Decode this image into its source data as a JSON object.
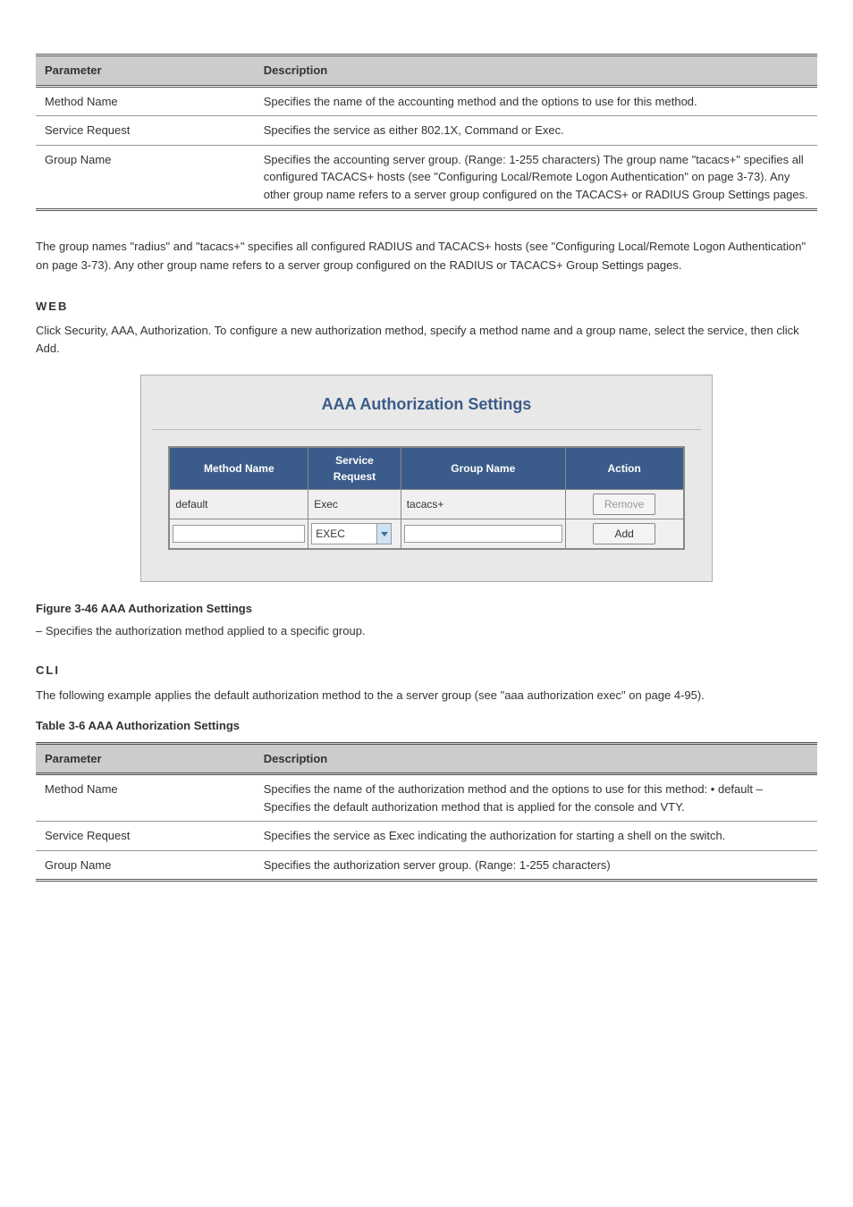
{
  "spec_table_top": {
    "headers": [
      "Parameter",
      "Description"
    ],
    "rows": [
      {
        "param": "Method Name",
        "desc": "Specifies the name of the accounting method and the options to use for this method."
      },
      {
        "param": "Service Request",
        "desc": "Specifies the service as either 802.1X, Command or Exec."
      },
      {
        "param": "Group Name",
        "desc": "Specifies the accounting server group. (Range: 1-255 characters)\nThe group name \"tacacs+\" specifies all configured TACACS+ hosts (see \"Configuring Local/Remote Logon Authentication\" on page 3-73). Any other group name refers to a server group configured on the TACACS+ or RADIUS Group Settings pages."
      }
    ]
  },
  "body_p1": "The group names \"radius\" and \"tacacs+\" specifies all configured RADIUS and TACACS+ hosts (see \"Configuring Local/Remote Logon Authentication\" on page 3-73). Any other group name refers to a server group configured on the RADIUS or TACACS+ Group Settings pages.",
  "web_heading": "WEB",
  "web_intro": "Click Security, AAA, Authorization. To configure a new authorization method, specify a method name and a group name, select the service, then click Add.",
  "screenshot": {
    "title": "AAA Authorization Settings",
    "headers": [
      "Method Name",
      "Service Request",
      "Group Name",
      "Action"
    ],
    "row_data": {
      "method": "default",
      "service": "Exec",
      "group": "tacacs+",
      "action": "Remove"
    },
    "row_input": {
      "method": "",
      "service_selected": "EXEC",
      "group": "",
      "action": "Add"
    }
  },
  "figure_caption": "Figure 3-46   AAA Authorization Settings",
  "figure_desc": "– Specifies the authorization method applied to a specific group.",
  "cli_heading": "CLI",
  "cli_text": "The following example applies the default authorization method to the a server group (see \"aaa authorization exec\" on page 4-95).",
  "table_caption": "Table 3-6   AAA Authorization Settings",
  "spec_table_bottom": {
    "headers": [
      "Parameter",
      "Description"
    ],
    "rows": [
      {
        "param": "Method Name",
        "desc": "Specifies the name of the authorization method and the options to use for this method:\n• default – Specifies the default authorization method that is applied for the console and VTY."
      },
      {
        "param": "Service Request",
        "desc": "Specifies the service as Exec indicating the authorization for starting a shell on the switch."
      },
      {
        "param": "Group Name",
        "desc": "Specifies the authorization server group. (Range: 1-255 characters)"
      }
    ]
  }
}
